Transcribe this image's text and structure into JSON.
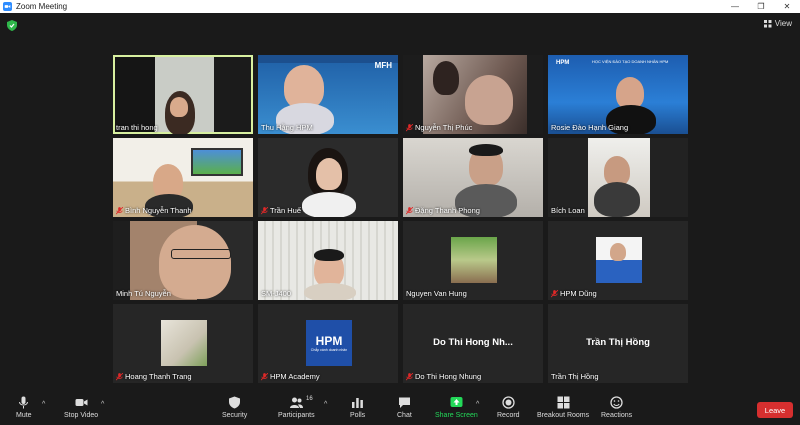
{
  "window": {
    "title": "Zoom Meeting"
  },
  "topbar": {
    "view_label": "View"
  },
  "participants": [
    {
      "name": "tran thi hong",
      "muted": false,
      "active": true
    },
    {
      "name": "Thu Hằng HPM",
      "muted": false
    },
    {
      "name": "Nguyễn Thị Phúc",
      "muted": true
    },
    {
      "name": "Rosie Đào Hạnh Giang",
      "muted": false
    },
    {
      "name": "Bình Nguyễn Thanh",
      "muted": true
    },
    {
      "name": "Trần Huế",
      "muted": true
    },
    {
      "name": "Đặng Thanh Phong",
      "muted": true
    },
    {
      "name": "Bích Loan",
      "muted": false
    },
    {
      "name": "Minh Tú Nguyễn",
      "muted": false
    },
    {
      "name": "SM-J400",
      "muted": false
    },
    {
      "name": "Nguyen Van Hung",
      "muted": false
    },
    {
      "name": "HPM Dũng",
      "muted": true
    },
    {
      "name": "Hoang Thanh Trang",
      "muted": true
    },
    {
      "name": "HPM Academy",
      "muted": true
    },
    {
      "name": "Do Thi Hong Nhung",
      "muted": true,
      "display": "Do Thi Hong Nh..."
    },
    {
      "name": "Trần Thị Hồng",
      "muted": false,
      "display": "Trần Thị Hồng"
    }
  ],
  "video_text": {
    "hpm_logo": "HPM",
    "hpm_sub": "Chắp cánh doanh nhân",
    "rosie_banner": "HỌC VIỆN ĐÀO TẠO DOANH NHÂN HPM",
    "thu_hang_banner": "MFH"
  },
  "toolbar": {
    "mute": "Mute",
    "stop_video": "Stop Video",
    "security": "Security",
    "participants": "Participants",
    "participant_count": "16",
    "polls": "Polls",
    "chat": "Chat",
    "share_screen": "Share Screen",
    "record": "Record",
    "breakout_rooms": "Breakout Rooms",
    "reactions": "Reactions",
    "leave": "Leave"
  },
  "colors": {
    "share_green": "#23d959",
    "leave_red": "#d62f2f",
    "active_border": "#d8f0a0",
    "muted_red": "#e02828"
  }
}
